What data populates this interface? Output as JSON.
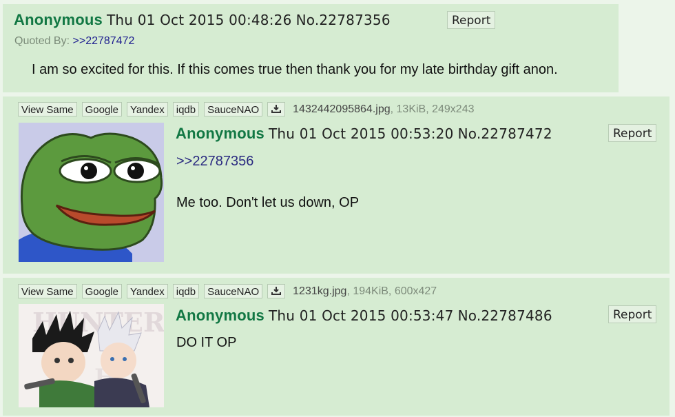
{
  "posts": [
    {
      "name": "Anonymous",
      "datetime": "Thu 01 Oct 2015 00:48:26",
      "postno": "No.22787356",
      "report": "Report",
      "quoted_by_label": "Quoted By:",
      "quoted_by_link": ">>22787472",
      "message": "I am so excited for this. If this comes true then thank you for my late birthday gift anon."
    },
    {
      "buttons": [
        "View Same",
        "Google",
        "Yandex",
        "iqdb",
        "SauceNAO"
      ],
      "download_icon": "download-icon",
      "file_name": "1432442095864.jpg",
      "file_meta": ", 13KiB, 249x243",
      "name": "Anonymous",
      "datetime": "Thu 01 Oct 2015 00:53:20",
      "postno": "No.22787472",
      "report": "Report",
      "quote_link": ">>22787356",
      "message": "Me too. Don't let us down, OP"
    },
    {
      "buttons": [
        "View Same",
        "Google",
        "Yandex",
        "iqdb",
        "SauceNAO"
      ],
      "download_icon": "download-icon",
      "file_name": "1231kg.jpg",
      "file_meta": ", 194KiB, 600x427",
      "name": "Anonymous",
      "datetime": "Thu 01 Oct 2015 00:53:47",
      "postno": "No.22787486",
      "report": "Report",
      "message": "DO IT OP"
    }
  ],
  "colors": {
    "post_bg": "#d6ecd2",
    "page_bg": "#ecf5ea",
    "name": "#117743"
  }
}
